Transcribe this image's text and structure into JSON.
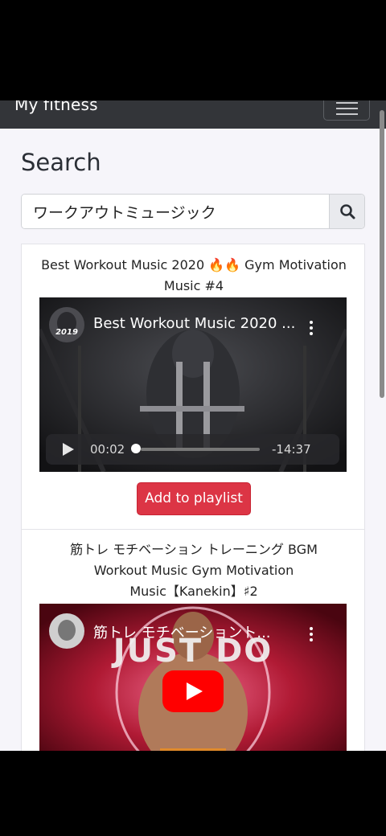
{
  "navbar": {
    "brand": "My fitness"
  },
  "page": {
    "title": "Search"
  },
  "search": {
    "value": "ワークアウトミュージック"
  },
  "results": [
    {
      "title": "Best Workout Music 2020 🔥🔥 Gym Motivation Music #4",
      "title_lines": [
        "Best Workout Music 2020 🔥🔥 Gym Motivation",
        "Music #4"
      ],
      "video": {
        "overlay_title": "Best Workout Music 2020 ...",
        "channel_badge": "2019",
        "elapsed": "00:02",
        "remaining": "-14:37",
        "progress_fraction": 0.003
      },
      "button_label": "Add to playlist"
    },
    {
      "title": "筋トレ モチベーション トレーニング BGM Workout Music Gym Motivation Music【Kanekin】♯2",
      "title_lines": [
        "筋トレ モチベーション トレーニング BGM",
        "Workout Music Gym Motivation",
        "Music【Kanekin】♯2"
      ],
      "video": {
        "overlay_title": "筋トレ モチベーショント...",
        "thumbnail_text": "JUST DO IT."
      }
    }
  ],
  "colors": {
    "navbar": "#333539",
    "background": "#f6f5fa",
    "primary_button": "#dc3545",
    "youtube_red": "#ff0000"
  },
  "icons": [
    "menu-icon",
    "search-icon",
    "play-icon",
    "more-vert-icon",
    "youtube-play-icon"
  ]
}
